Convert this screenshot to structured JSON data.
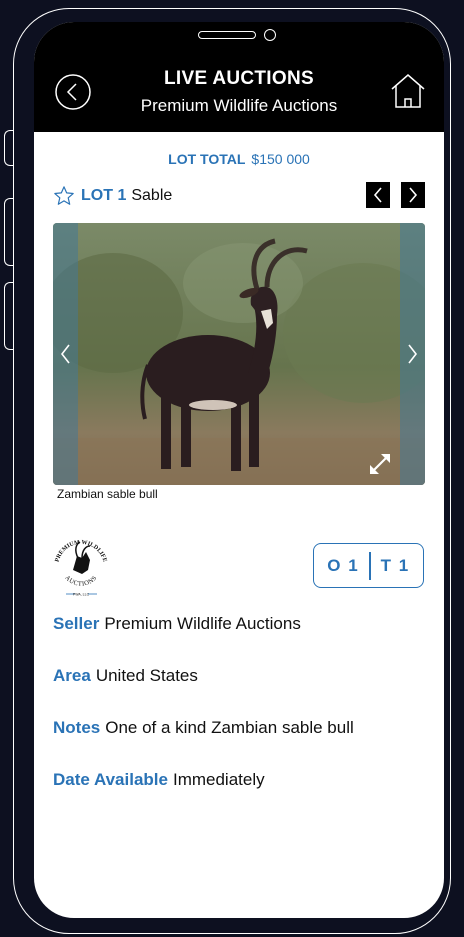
{
  "header": {
    "title": "LIVE AUCTIONS",
    "subtitle": "Premium Wildlife Auctions",
    "back_icon": "chevron-left-circle-icon",
    "home_icon": "home-icon"
  },
  "lot_total": {
    "label": "LOT TOTAL",
    "value": "$150 000"
  },
  "lot": {
    "favorite_icon": "star-outline-icon",
    "number": "LOT 1",
    "name": "Sable",
    "prev_icon": "chevron-left-icon",
    "next_icon": "chevron-right-icon"
  },
  "gallery": {
    "image": "sable antelope bull photo",
    "caption": "Zambian sable bull",
    "expand_icon": "expand-icon"
  },
  "seller_logo": {
    "top_text": "PREMIUM WILDLIFE",
    "bottom_text": "AUCTIONS",
    "small_text": "PWA, LLC"
  },
  "badge": {
    "o": "O 1",
    "t": "T 1"
  },
  "details": [
    {
      "key": "Seller",
      "value": "Premium Wildlife Auctions"
    },
    {
      "key": "Area",
      "value": "United States"
    },
    {
      "key": "Notes",
      "value": "One of a kind Zambian sable bull"
    },
    {
      "key": "Date Available",
      "value": "Immediately"
    }
  ],
  "colors": {
    "accent": "#2a73b6",
    "header_bg": "#000000",
    "frame_bg": "#0d1020"
  }
}
